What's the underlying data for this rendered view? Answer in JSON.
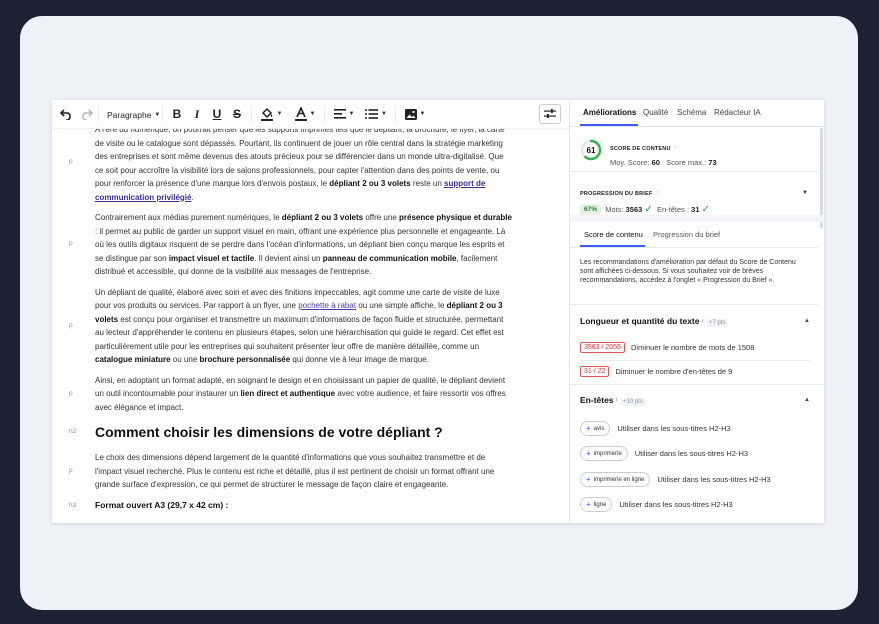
{
  "toolbar": {
    "paragraph_label": "Paragraphe"
  },
  "doc": {
    "p1": {
      "tag": "p",
      "t1": "A l'ère du numérique, on pourrait penser que les supports imprimés tels que le dépliant, la brochure, le flyer, la carte de visite ou le catalogue sont dépassés. Pourtant, ils continuent de jouer un rôle central dans la stratégie marketing des entreprises et sont même devenus des atouts précieux pour se différencier dans un monde ultra-digitalisé. Que ce soit pour accroître la visibilité lors de salons professionnels, pour capter l'attention dans des points de vente, ou pour renforcer la présence d'une marque lors d'envois postaux, le ",
      "b1": "dépliant 2 ou 3 volets",
      "t2": " reste un ",
      "link": "support de communication privilégié",
      "t3": "."
    },
    "p2": {
      "tag": "p",
      "t1": "Contrairement aux médias purement numériques, le ",
      "b1": "dépliant 2 ou 3 volets",
      "t2": " offre une ",
      "b2": "présence physique et durable",
      "t3": " : il permet au public de garder un support visuel en main, offrant une expérience plus personnelle et engageante. Là où les outils digitaux risquent de se perdre dans l'océan d'informations, un dépliant bien conçu marque les esprits et se distingue par son ",
      "b3": "impact visuel et tactile",
      "t4": ". Il devient ainsi un ",
      "b4": "panneau de communication mobile",
      "t5": ", facilement distribué et accessible, qui donne de la visibilité aux messages de l'entreprise."
    },
    "p3": {
      "tag": "p",
      "t1": "Un dépliant de qualité, élaboré avec soin et avec des finitions impeccables, agit comme une carte de visite de luxe pour vos produits ou services. Par rapport à un flyer, une ",
      "link": "pochette à rabat",
      "t2": " ou une simple affiche, le ",
      "b1": "dépliant 2 ou 3 volets",
      "t3": " est conçu pour organiser et transmettre un maximum d'informations de façon fluide et structurée, permettant au lecteur d'appréhender le contenu en plusieurs étapes, selon une hiérarchisation qui guide le regard. Cet effet est particulièrement utile pour les entreprises qui souhaitent présenter leur offre de manière détaillée, comme un ",
      "b2": "catalogue miniature",
      "t4": " ou une ",
      "b3": "brochure personnalisée",
      "t5": " qui donne vie à leur image de marque."
    },
    "p4": {
      "tag": "p",
      "t1": "Ainsi, en adoptant un format adapté, en soignant le design et en choisissant un papier de qualité, le dépliant devient un outil incontournable pour instaurer un ",
      "b1": "lien direct et authentique",
      "t2": " avec votre audience, et faire ressortir vos offres avec élégance et impact."
    },
    "h2": {
      "tag": "h2",
      "text": "Comment choisir les dimensions de votre dépliant ?"
    },
    "p5": {
      "tag": "p",
      "text": "Le choix des dimensions dépend largement de la quantité d'informations que vous souhaitez transmettre et de l'impact visuel recherché. Plus le contenu est riche et détaillé, plus il est pertinent de choisir un format offrant une grande surface d'expression, ce qui permet de structurer le message de façon claire et engageante."
    },
    "h3": {
      "tag": "h3",
      "text": "Format ouvert A3 (29,7 x 42 cm) :"
    }
  },
  "sidebar": {
    "tabs": [
      "Améliorations",
      "Qualité",
      "Schéma",
      "Rédacteur IA"
    ],
    "score": {
      "label": "SCORE DE CONTENU",
      "value": "61",
      "value_fraction": 0.61,
      "avg_label": "Moy. Score:",
      "avg": "60",
      "max_label": "Score max.:",
      "max": "73"
    },
    "progress": {
      "label": "PROGRESSION DU BRIEF",
      "percent": "67%",
      "words_label": "Mots:",
      "words": "3563",
      "headings_label": "En-têtes :",
      "headings": "31"
    },
    "subtabs": [
      "Score de contenu",
      "Progression du brief"
    ],
    "description": "Les recommandations d'amélioration par défaut du Score de Contenu sont affichées ci-dessous. Si vous souhaitez voir de brèves recommandations, accédez à l'onglet « Progression du Brief ».",
    "length_section": {
      "title": "Longueur et quantité du texte",
      "points": "+7 pts",
      "items": [
        {
          "badge": "3563 / 2055",
          "text": "Diminuer le nombre de mots de 1508"
        },
        {
          "badge": "31 / 22",
          "text": "Diminuer le nombre d'en-têtes de 9"
        }
      ]
    },
    "headings_section": {
      "title": "En-têtes",
      "points": "+10 pts",
      "items": [
        {
          "chip": "avis",
          "text": "Utiliser dans les sous-titres H2-H3"
        },
        {
          "chip": "imprimerie",
          "text": "Utiliser dans les sous-titres H2-H3"
        },
        {
          "chip": "imprimerie en ligne",
          "text": "Utiliser dans les sous-titres H2-H3"
        },
        {
          "chip": "ligne",
          "text": "Utiliser dans les sous-titres H2-H3"
        }
      ]
    },
    "colors": {
      "accent": "#3d5bf5",
      "good": "#2ba24c",
      "bad": "#d13b3b"
    }
  }
}
